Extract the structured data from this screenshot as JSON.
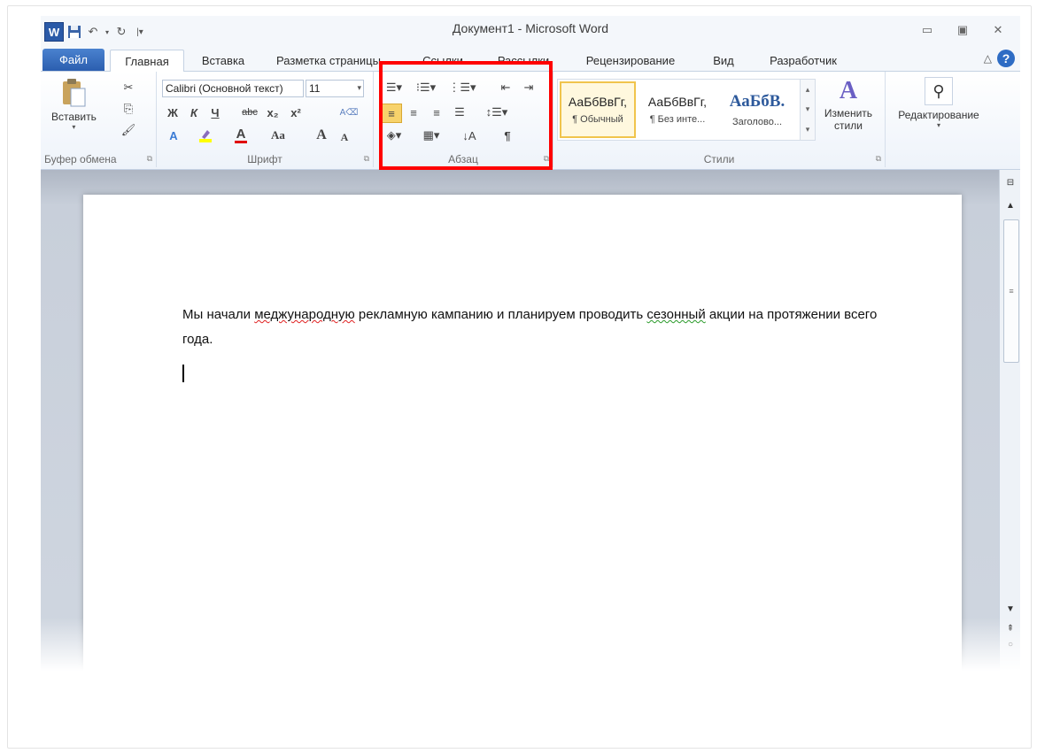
{
  "title": "Документ1 - Microsoft Word",
  "qat": {
    "logo": "W",
    "save_icon": "save-icon",
    "undo_icon": "undo-icon",
    "redo_icon": "redo-icon",
    "customize_icon": "customize-qat-icon"
  },
  "tabs": [
    {
      "label": "Файл"
    },
    {
      "label": "Главная"
    },
    {
      "label": "Вставка"
    },
    {
      "label": "Разметка страницы"
    },
    {
      "label": "Ссылки"
    },
    {
      "label": "Рассылки"
    },
    {
      "label": "Рецензирование"
    },
    {
      "label": "Вид"
    },
    {
      "label": "Разработчик"
    }
  ],
  "ribbon": {
    "clipboard": {
      "paste_label": "Вставить",
      "group_label": "Буфер обмена"
    },
    "font": {
      "font_name": "Calibri (Основной текст)",
      "font_size": "11",
      "bold": "Ж",
      "italic": "К",
      "underline": "Ч",
      "strike": "abc",
      "subscript": "x₂",
      "superscript": "x²",
      "change_case": "Aa",
      "grow": "A",
      "shrink": "A",
      "color_letter": "A",
      "group_label": "Шрифт"
    },
    "paragraph": {
      "group_label": "Абзац",
      "show_marks": "¶"
    },
    "styles": {
      "items": [
        {
          "sample": "АаБбВвГг,",
          "name": "¶ Обычный"
        },
        {
          "sample": "АаБбВвГг,",
          "name": "¶ Без инте..."
        },
        {
          "sample": "АаБбВ.",
          "name": "Заголово..."
        }
      ],
      "change_styles": "Изменить стили",
      "group_label": "Стили"
    },
    "editing": {
      "label": "Редактирование"
    }
  },
  "document": {
    "parts": [
      "Мы начали ",
      "меджународную",
      " рекламную кампанию и планируем проводить ",
      "сезонный",
      " акции на протяжении всего года."
    ]
  },
  "colors": {
    "accent": "#2b5eaf",
    "highlight": "#ff0000",
    "style_selected": "#f0c44c"
  }
}
